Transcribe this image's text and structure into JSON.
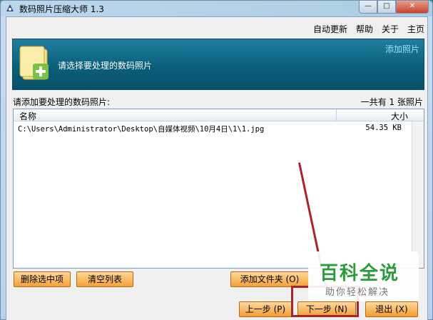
{
  "window": {
    "title": "数码照片压缩大师 1.3"
  },
  "menu": [
    "自动更新",
    "帮助",
    "关于",
    "主页"
  ],
  "banner": {
    "instruction": "请选择要处理的数码照片",
    "link": "添加照片"
  },
  "list": {
    "label": "请添加要处理的数码照片:",
    "count": "一共有 1 张照片",
    "columns": {
      "name": "名称",
      "size": "大小"
    },
    "rows": [
      {
        "path": "C:\\Users\\Administrator\\Desktop\\自媒体视频\\10月4日\\1\\1.jpg",
        "size": "54.35 KB"
      }
    ]
  },
  "buttons": {
    "delete_selected": "删除选中项",
    "clear_list": "清空列表",
    "add_folder": "添加文件夹 (O)",
    "prev": "上一步 (P)",
    "next": "下一步 (N)",
    "exit": "退出 (X)"
  },
  "watermark": {
    "title": "百科全说",
    "subtitle": "助你轻松解决"
  },
  "colors": {
    "banner": "#0b5f7a",
    "button": "#f4a23a",
    "highlight": "#a9232a",
    "watermark": "#2c9b3c"
  },
  "icons": [
    "app-icon",
    "folder-add-icon",
    "minimize-icon",
    "maximize-icon",
    "close-icon"
  ]
}
